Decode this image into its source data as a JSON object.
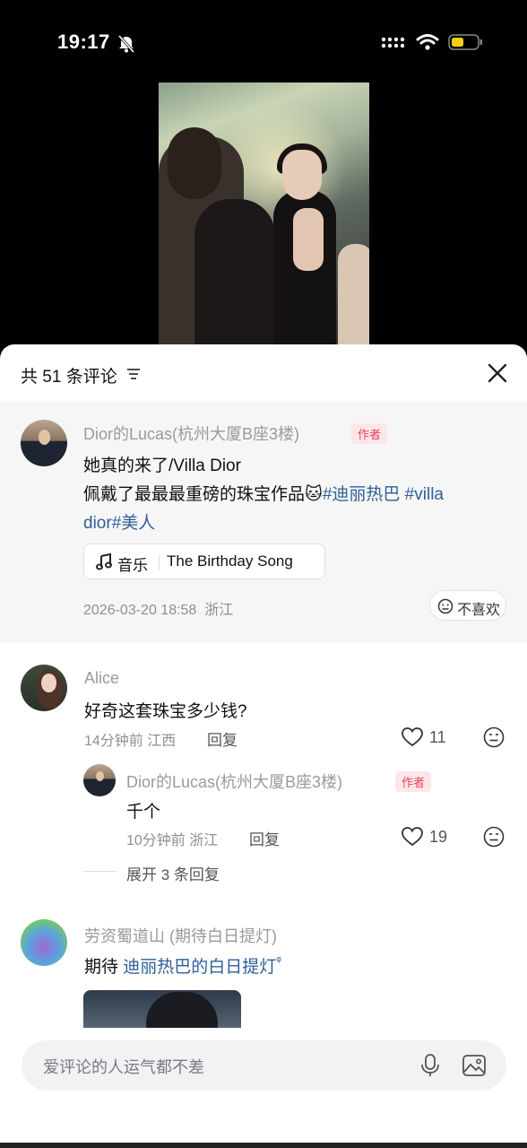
{
  "status_bar": {
    "time": "19:17"
  },
  "header": {
    "comment_count": "共 51 条评论"
  },
  "pinned": {
    "author": "Dior的Lucas(杭州大厦B座3楼)",
    "author_tag": "作者",
    "line1": "她真的来了/Villa Dior",
    "line2_text": "佩戴了最最最重磅的珠宝作品",
    "line2_emoji": "🐱",
    "line2_tag1": "#迪丽热巴",
    "line2_tag2_start": " #villa",
    "line3_tag2_end": "dior",
    "line3_tag3": "#美人",
    "music_label": "音乐",
    "music_song": "The Birthday Song",
    "timestamp": "2026-03-20 18:58",
    "location": "浙江",
    "dislike_label": "不喜欢"
  },
  "comments": [
    {
      "name": "Alice",
      "text": "好奇这套珠宝多少钱?",
      "meta": "14分钟前 江西",
      "reply_label": "回复",
      "likes": "11",
      "reply": {
        "name": "Dior的Lucas(杭州大厦B座3楼)",
        "tag": "作者",
        "text": "千个",
        "meta": "10分钟前 浙江",
        "reply_label": "回复",
        "likes": "19"
      },
      "expand_label": "展开 3 条回复"
    },
    {
      "name": "劳资蜀道山 (期待白日提灯)",
      "text_prefix": "期待 ",
      "text_link": "迪丽热巴的白日提灯",
      "text_suffix": "ᵠ"
    }
  ],
  "input": {
    "placeholder": "爱评论的人运气都不差"
  },
  "colors": {
    "link": "#2f5e97",
    "author_tag": "#e8435a",
    "battery": "#f5d10d"
  }
}
